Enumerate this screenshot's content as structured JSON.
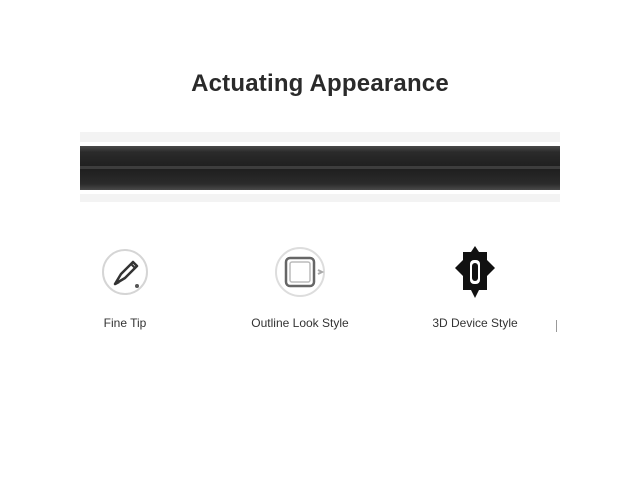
{
  "heading": {
    "title": "Actuating Appearance"
  },
  "toolbar": {
    "items": [
      {
        "label": "Fine Tip",
        "icon": "pen-tip-icon"
      },
      {
        "label": "Outline Look Style",
        "icon": "outline-square-icon"
      },
      {
        "label": "3D Device Style",
        "icon": "dark-device-icon"
      }
    ],
    "more_indicator": "|"
  },
  "colors": {
    "bar": "#222222",
    "background": "#ffffff",
    "text": "#2a2a2a"
  }
}
